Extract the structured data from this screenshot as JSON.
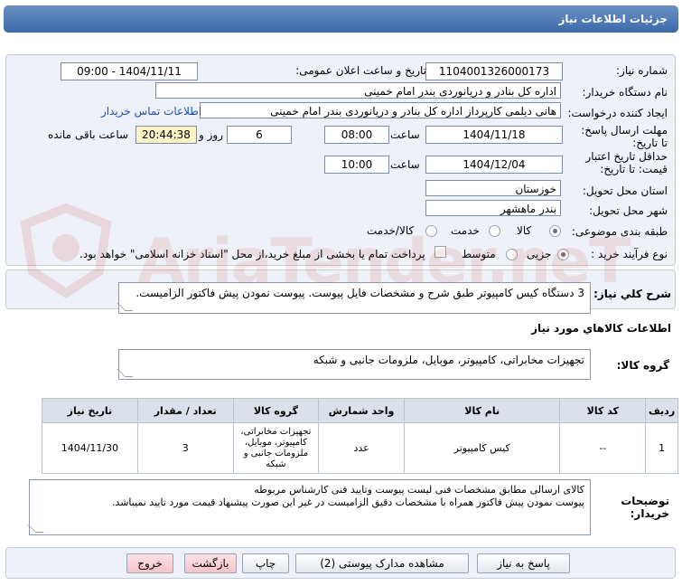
{
  "header": {
    "title": "جزئیات اطلاعات نیاز"
  },
  "form": {
    "need_number_label": "شماره نیاز:",
    "need_number": "1104001326000173",
    "announce_label": "تاریخ و ساعت اعلان عمومی:",
    "announce_value": "1404/11/11 - 09:00",
    "buyer_org_label": "نام دستگاه خریدار:",
    "buyer_org": "اداره کل بنادر و دریانوردی بندر امام خمینی",
    "creator_label": "ایجاد کننده درخواست:",
    "creator": "هانی دیلمی کارپرداز اداره کل بنادر و دریانوردی بندر امام خمینی",
    "contact_link": "اطلاعات تماس خریدار",
    "deadline_label": "مهلت ارسال پاسخ: تا تاریخ:",
    "deadline_date": "1404/11/18",
    "time_label": "ساعت",
    "deadline_time": "08:00",
    "days": "6",
    "days_label": "روز و",
    "remaining": "20:44:38",
    "remaining_label": "ساعت باقی مانده",
    "validity_label": "حداقل تاریخ اعتبار قیمت: تا تاریخ:",
    "validity_date": "1404/12/04",
    "validity_time": "10:00",
    "province_label": "استان محل تحویل:",
    "province": "خوزستان",
    "city_label": "شهر محل تحویل:",
    "city": "بندر ماهشهر",
    "category_label": "طبقه بندی موضوعی:",
    "category_options": [
      "کالا",
      "خدمت",
      "کالا/خدمت"
    ],
    "process_label": "نوع فرآیند خرید :",
    "process_options": [
      "جزیی",
      "متوسط"
    ],
    "payment_note": "پرداخت تمام یا بخشی از مبلغ خرید،از محل \"اسناد خزانه اسلامی\" خواهد بود."
  },
  "description": {
    "label": "شرح کلي نياز:",
    "text": "3 دستگاه کیس کامپیوتر طبق شرح و مشخصات فایل پیوست. پیوست نمودن پیش فاکتور الزامیست."
  },
  "goods": {
    "section_title": "اطلاعات کالاهاي مورد نياز",
    "group_label": "گروه کالا:",
    "group_value": "تجهیزات مخابراتی، کامپیوتر، موبایل، ملزومات جانبی و شبکه",
    "table": {
      "headers": [
        "ردیف",
        "کد کالا",
        "نام کالا",
        "واحد شمارش",
        "گروه کالا",
        "تعداد / مقدار",
        "تاریخ نیاز"
      ],
      "rows": [
        [
          "1",
          "--",
          "کیس کامپیوتر",
          "عدد",
          "تجهیزات مخابراتی، کامپیوتر، موبایل، ملزومات جانبی و شبکه",
          "3",
          "1404/11/30"
        ]
      ]
    }
  },
  "buyer_notes": {
    "label": "توضیحات خریدار:",
    "line1": "کالای ارسالی مطابق مشخصات فنی لیست پیوست وتایید فنی کارشناس مربوطه",
    "line2": "پیوست نمودن پیش فاکتور همراه با مشخصات دقیق الزامیست در غیر این صورت پیشنهاد قیمت مورد تایید نمیباشد."
  },
  "buttons": {
    "reply": "پاسخ به نیاز",
    "view_docs": "مشاهده مدارک پیوستی (2)",
    "print": "چاپ",
    "back": "بازگشت",
    "exit": "خروج"
  },
  "watermark": "AriaTender.neT"
}
